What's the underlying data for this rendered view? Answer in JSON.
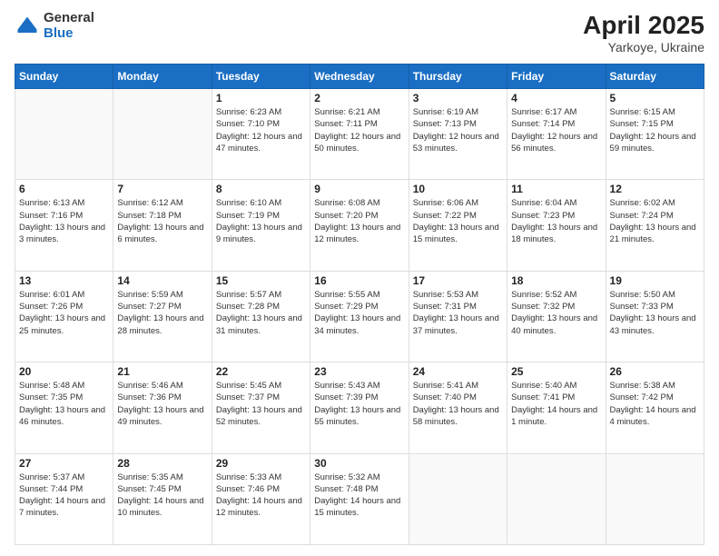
{
  "header": {
    "logo": {
      "general": "General",
      "blue": "Blue"
    },
    "title": "April 2025",
    "location": "Yarkoye, Ukraine"
  },
  "weekdays": [
    "Sunday",
    "Monday",
    "Tuesday",
    "Wednesday",
    "Thursday",
    "Friday",
    "Saturday"
  ],
  "weeks": [
    [
      {
        "day": "",
        "info": ""
      },
      {
        "day": "",
        "info": ""
      },
      {
        "day": "1",
        "info": "Sunrise: 6:23 AM\nSunset: 7:10 PM\nDaylight: 12 hours and 47 minutes."
      },
      {
        "day": "2",
        "info": "Sunrise: 6:21 AM\nSunset: 7:11 PM\nDaylight: 12 hours and 50 minutes."
      },
      {
        "day": "3",
        "info": "Sunrise: 6:19 AM\nSunset: 7:13 PM\nDaylight: 12 hours and 53 minutes."
      },
      {
        "day": "4",
        "info": "Sunrise: 6:17 AM\nSunset: 7:14 PM\nDaylight: 12 hours and 56 minutes."
      },
      {
        "day": "5",
        "info": "Sunrise: 6:15 AM\nSunset: 7:15 PM\nDaylight: 12 hours and 59 minutes."
      }
    ],
    [
      {
        "day": "6",
        "info": "Sunrise: 6:13 AM\nSunset: 7:16 PM\nDaylight: 13 hours and 3 minutes."
      },
      {
        "day": "7",
        "info": "Sunrise: 6:12 AM\nSunset: 7:18 PM\nDaylight: 13 hours and 6 minutes."
      },
      {
        "day": "8",
        "info": "Sunrise: 6:10 AM\nSunset: 7:19 PM\nDaylight: 13 hours and 9 minutes."
      },
      {
        "day": "9",
        "info": "Sunrise: 6:08 AM\nSunset: 7:20 PM\nDaylight: 13 hours and 12 minutes."
      },
      {
        "day": "10",
        "info": "Sunrise: 6:06 AM\nSunset: 7:22 PM\nDaylight: 13 hours and 15 minutes."
      },
      {
        "day": "11",
        "info": "Sunrise: 6:04 AM\nSunset: 7:23 PM\nDaylight: 13 hours and 18 minutes."
      },
      {
        "day": "12",
        "info": "Sunrise: 6:02 AM\nSunset: 7:24 PM\nDaylight: 13 hours and 21 minutes."
      }
    ],
    [
      {
        "day": "13",
        "info": "Sunrise: 6:01 AM\nSunset: 7:26 PM\nDaylight: 13 hours and 25 minutes."
      },
      {
        "day": "14",
        "info": "Sunrise: 5:59 AM\nSunset: 7:27 PM\nDaylight: 13 hours and 28 minutes."
      },
      {
        "day": "15",
        "info": "Sunrise: 5:57 AM\nSunset: 7:28 PM\nDaylight: 13 hours and 31 minutes."
      },
      {
        "day": "16",
        "info": "Sunrise: 5:55 AM\nSunset: 7:29 PM\nDaylight: 13 hours and 34 minutes."
      },
      {
        "day": "17",
        "info": "Sunrise: 5:53 AM\nSunset: 7:31 PM\nDaylight: 13 hours and 37 minutes."
      },
      {
        "day": "18",
        "info": "Sunrise: 5:52 AM\nSunset: 7:32 PM\nDaylight: 13 hours and 40 minutes."
      },
      {
        "day": "19",
        "info": "Sunrise: 5:50 AM\nSunset: 7:33 PM\nDaylight: 13 hours and 43 minutes."
      }
    ],
    [
      {
        "day": "20",
        "info": "Sunrise: 5:48 AM\nSunset: 7:35 PM\nDaylight: 13 hours and 46 minutes."
      },
      {
        "day": "21",
        "info": "Sunrise: 5:46 AM\nSunset: 7:36 PM\nDaylight: 13 hours and 49 minutes."
      },
      {
        "day": "22",
        "info": "Sunrise: 5:45 AM\nSunset: 7:37 PM\nDaylight: 13 hours and 52 minutes."
      },
      {
        "day": "23",
        "info": "Sunrise: 5:43 AM\nSunset: 7:39 PM\nDaylight: 13 hours and 55 minutes."
      },
      {
        "day": "24",
        "info": "Sunrise: 5:41 AM\nSunset: 7:40 PM\nDaylight: 13 hours and 58 minutes."
      },
      {
        "day": "25",
        "info": "Sunrise: 5:40 AM\nSunset: 7:41 PM\nDaylight: 14 hours and 1 minute."
      },
      {
        "day": "26",
        "info": "Sunrise: 5:38 AM\nSunset: 7:42 PM\nDaylight: 14 hours and 4 minutes."
      }
    ],
    [
      {
        "day": "27",
        "info": "Sunrise: 5:37 AM\nSunset: 7:44 PM\nDaylight: 14 hours and 7 minutes."
      },
      {
        "day": "28",
        "info": "Sunrise: 5:35 AM\nSunset: 7:45 PM\nDaylight: 14 hours and 10 minutes."
      },
      {
        "day": "29",
        "info": "Sunrise: 5:33 AM\nSunset: 7:46 PM\nDaylight: 14 hours and 12 minutes."
      },
      {
        "day": "30",
        "info": "Sunrise: 5:32 AM\nSunset: 7:48 PM\nDaylight: 14 hours and 15 minutes."
      },
      {
        "day": "",
        "info": ""
      },
      {
        "day": "",
        "info": ""
      },
      {
        "day": "",
        "info": ""
      }
    ]
  ]
}
